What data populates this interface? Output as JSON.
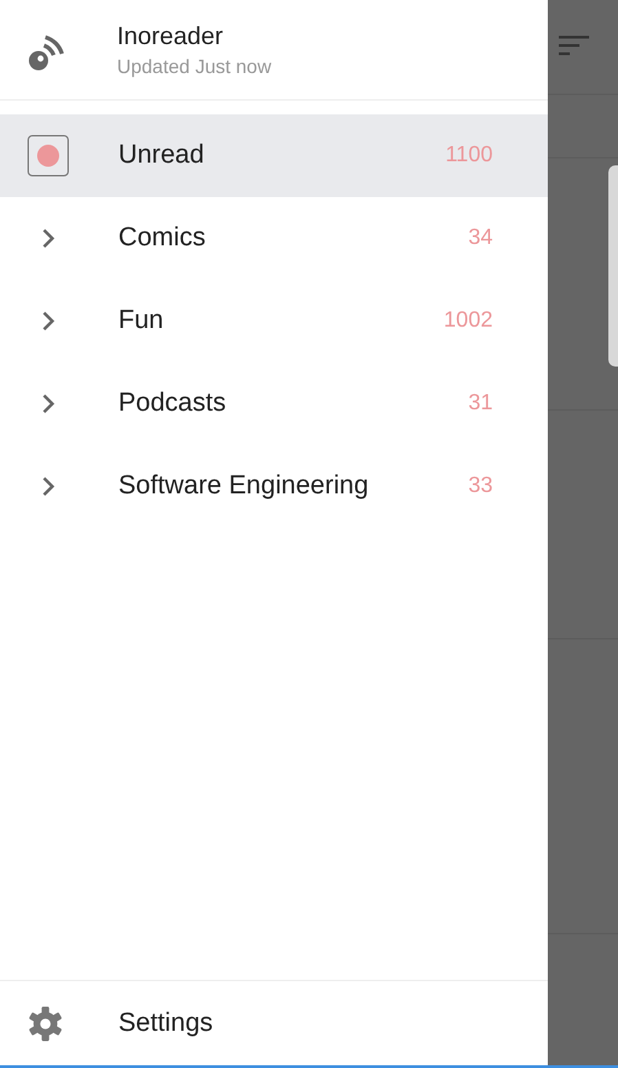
{
  "header": {
    "title": "Inoreader",
    "subtitle": "Updated Just now"
  },
  "items": [
    {
      "kind": "unread",
      "label": "Unread",
      "count": "1100",
      "selected": true
    },
    {
      "kind": "folder",
      "label": "Comics",
      "count": "34",
      "selected": false
    },
    {
      "kind": "folder",
      "label": "Fun",
      "count": "1002",
      "selected": false
    },
    {
      "kind": "folder",
      "label": "Podcasts",
      "count": "31",
      "selected": false
    },
    {
      "kind": "folder",
      "label": "Software Engineering",
      "count": "33",
      "selected": false
    }
  ],
  "footer": {
    "label": "Settings"
  }
}
